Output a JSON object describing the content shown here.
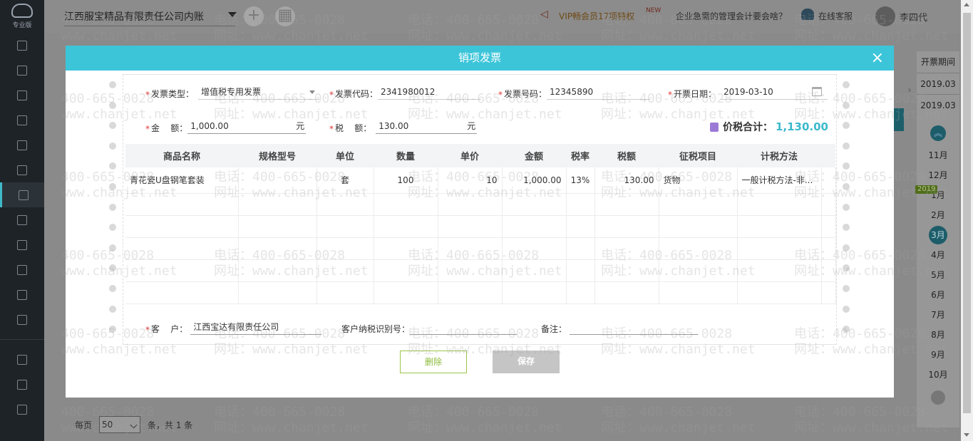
{
  "topbar": {
    "company": "江西服宝精品有限责任公司内账",
    "vip_text": "VIP畅会员17项特权",
    "new_tag": "NEW",
    "question_text": "企业急需的管理会计要会啥？",
    "service_text": "在线客服",
    "user_name": "李四代"
  },
  "sidebar": {
    "logo_text": "专业版"
  },
  "modal": {
    "title": "销项发票",
    "close": "×",
    "invoice_type_label": "发票类型：",
    "invoice_type_value": "增值税专用发票",
    "invoice_code_label": "发票代码：",
    "invoice_code_value": "2341980012",
    "invoice_no_label": "发票号码：",
    "invoice_no_value": "12345890",
    "issue_date_label": "开票日期：",
    "issue_date_value": "2019-03-10",
    "amount_label": "金    额：",
    "amount_value": "1,000.00",
    "amount_unit": "元",
    "tax_label": "税    额：",
    "tax_value": "130.00",
    "tax_unit": "元",
    "total_label": "价税合计：",
    "total_value": "1,130.00",
    "table": {
      "headers": [
        "商品名称",
        "规格型号",
        "单位",
        "数量",
        "单价",
        "金额",
        "税率",
        "税额",
        "征税项目",
        "计税方法"
      ],
      "row": [
        "青花瓷U盘钢笔套装",
        "",
        "套",
        "100",
        "10",
        "1,000.00",
        "13%",
        "130.00",
        "货物",
        "一般计税方法-非..."
      ]
    },
    "customer_label": "客    户：",
    "customer_value": "江西宝达有限责任公司",
    "taxid_label": "客户纳税识别号：",
    "taxid_value": "",
    "note_label": "备注：",
    "note_value": "",
    "delete_label": "删除",
    "save_label": "保存"
  },
  "pager": {
    "per_page_label": "每页",
    "per_page_value": "50",
    "summary": "条，共 1 条"
  },
  "date_panel": {
    "header": "开票期间",
    "dates": [
      "2019.03",
      "2019.03"
    ],
    "year_tag": "2019",
    "months": [
      "11月",
      "12月",
      "1月",
      "2月",
      "3月",
      "4月",
      "5月",
      "6月",
      "7月",
      "8月",
      "9月",
      "10月"
    ],
    "current_month": "3月"
  },
  "watermark": {
    "phone": "电话：400-665-0028",
    "site": "网址：www.chanjet.net",
    "phone_short": "400-665-0028",
    "site_short": "www.chanjet.net"
  },
  "colors": {
    "accent": "#3cc5d9",
    "required": "#e0383a",
    "delete_border": "#9cc54a",
    "total_amount": "#3cb9cc"
  }
}
